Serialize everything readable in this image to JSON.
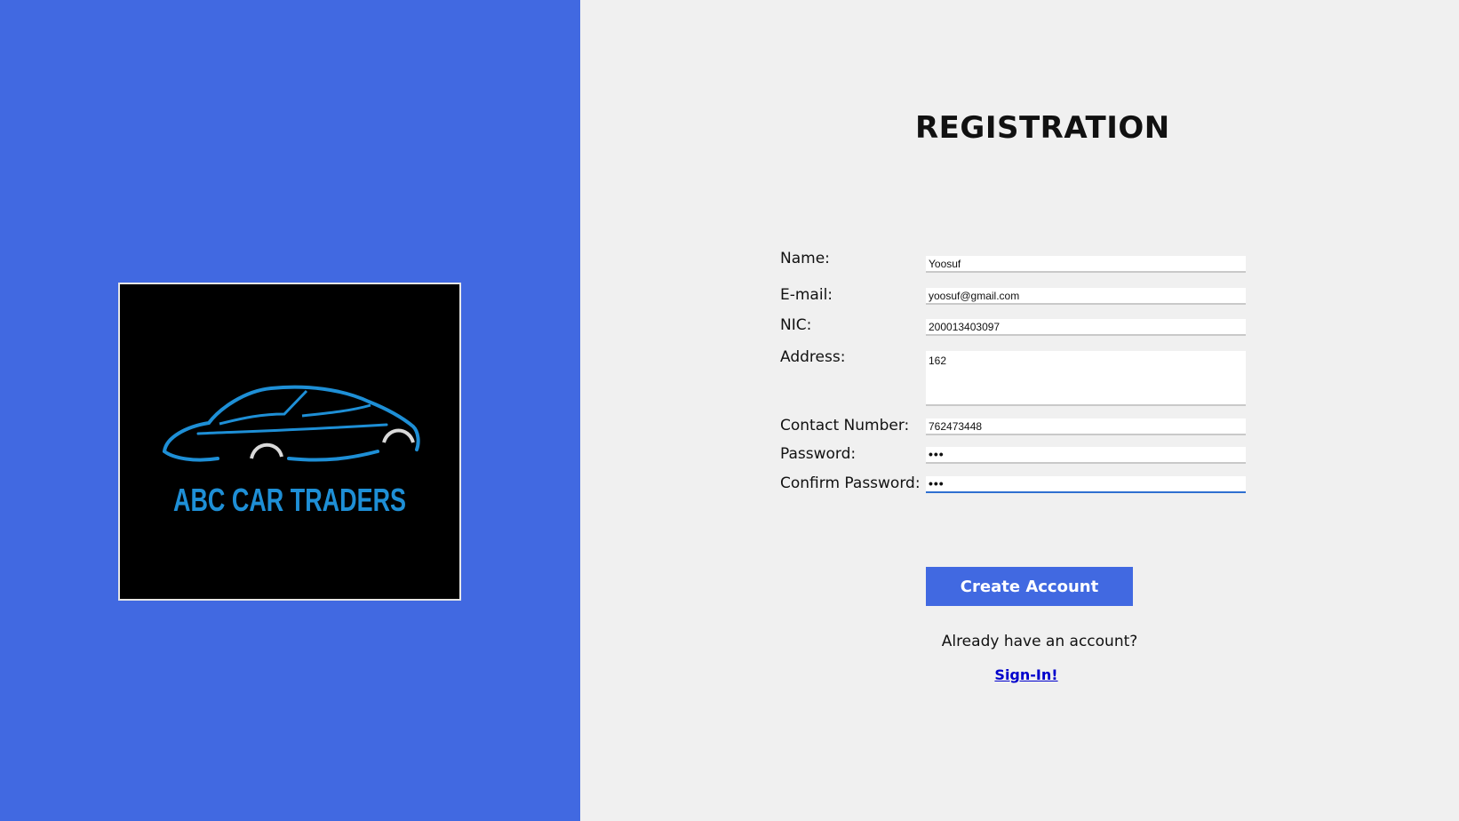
{
  "branding": {
    "logo_text": "ABC CAR TRADERS",
    "panel_color": "#4169e1",
    "logo_accent": "#1e8fd6"
  },
  "form": {
    "title": "REGISTRATION",
    "fields": {
      "name": {
        "label": "Name:",
        "value": "Yoosuf"
      },
      "email": {
        "label": "E-mail:",
        "value": "yoosuf@gmail.com"
      },
      "nic": {
        "label": "NIC:",
        "value": "200013403097"
      },
      "address": {
        "label": "Address:",
        "value": "162"
      },
      "contact": {
        "label": "Contact Number:",
        "value": "762473448"
      },
      "password": {
        "label": "Password:",
        "value": "•••"
      },
      "confirm_password": {
        "label": "Confirm Password:",
        "value": "•••"
      }
    },
    "submit_label": "Create Account",
    "signin_prompt": "Already have an account?",
    "signin_link": "Sign-In!"
  }
}
